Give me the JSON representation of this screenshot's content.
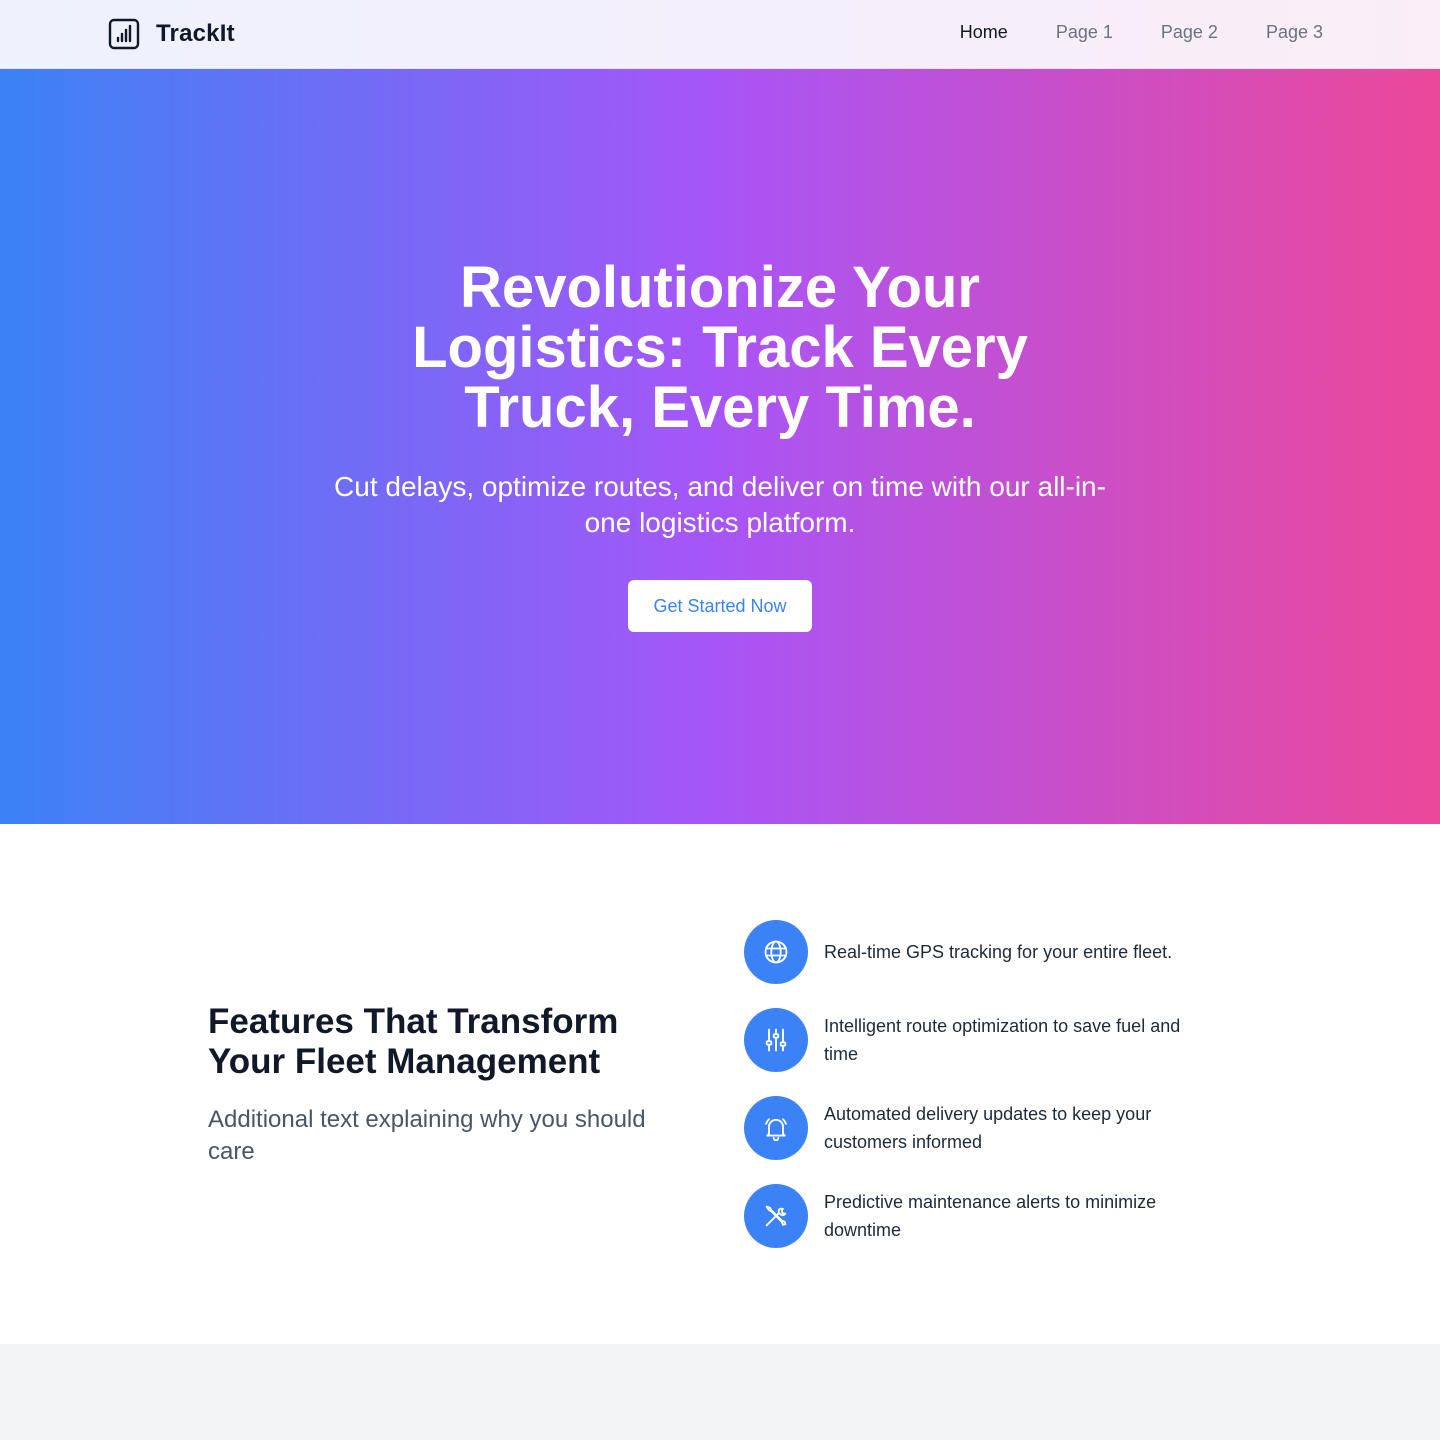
{
  "brand": {
    "name": "TrackIt",
    "icon": "bar-chart-icon"
  },
  "nav": {
    "items": [
      {
        "label": "Home",
        "active": true
      },
      {
        "label": "Page 1",
        "active": false
      },
      {
        "label": "Page 2",
        "active": false
      },
      {
        "label": "Page 3",
        "active": false
      }
    ]
  },
  "hero": {
    "title": "Revolutionize Your Logistics: Track Every Truck, Every Time.",
    "subtitle": "Cut delays, optimize routes, and deliver on time with our all-in-one logistics platform.",
    "cta_label": "Get Started Now"
  },
  "features": {
    "heading": "Features That Transform Your Fleet Management",
    "description": "Additional text explaining why you should care",
    "items": [
      {
        "icon": "globe-icon",
        "text": "Real-time GPS tracking for your entire fleet."
      },
      {
        "icon": "sliders-icon",
        "text": "Intelligent route optimization to save fuel and time"
      },
      {
        "icon": "bell-icon",
        "text": "Automated delivery updates to keep your customers informed"
      },
      {
        "icon": "tools-icon",
        "text": "Predictive maintenance alerts to minimize downtime"
      }
    ]
  },
  "colors": {
    "accent": "#3b82f6",
    "gradient_start": "#3b82f6",
    "gradient_mid": "#a855f7",
    "gradient_end": "#ec4899",
    "heading_text": "#111827",
    "muted_text": "#6b7280"
  }
}
